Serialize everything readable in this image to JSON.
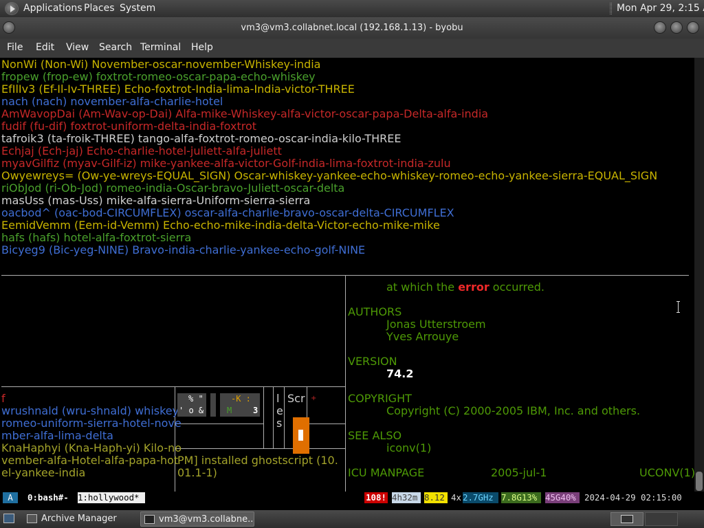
{
  "top_panel": {
    "menus": [
      "Applications",
      "Places",
      "System"
    ],
    "clock": "Mon Apr 29,  2:15 AM"
  },
  "window": {
    "title": "vm3@vm3.collabnet.local (192.168.1.13) - byobu"
  },
  "menubar": [
    "File",
    "Edit",
    "View",
    "Search",
    "Terminal",
    "Help"
  ],
  "upper_lines": [
    {
      "text": "NonWi (Non-Wi) November-oscar-november-Whiskey-india",
      "color": "yel"
    },
    {
      "text": "fropew (frop-ew) foxtrot-romeo-oscar-papa-echo-whiskey",
      "color": "grn"
    },
    {
      "text": "EfIlIv3 (Ef-Il-Iv-THREE) Echo-foxtrot-India-lima-India-victor-THREE",
      "color": "yel"
    },
    {
      "text": "nach (nach) november-alfa-charlie-hotel",
      "color": "blu"
    },
    {
      "text": "AmWavopDai (Am-Wav-op-Dai) Alfa-mike-Whiskey-alfa-victor-oscar-papa-Delta-alfa-india",
      "color": "red"
    },
    {
      "text": "fudif (fu-dif) foxtrot-uniform-delta-india-foxtrot",
      "color": "red"
    },
    {
      "text": "tafroik3 (ta-froik-THREE) tango-alfa-foxtrot-romeo-oscar-india-kilo-THREE",
      "color": "wht"
    },
    {
      "text": "Echjaj (Ech-jaj) Echo-charlie-hotel-juliett-alfa-juliett",
      "color": "red"
    },
    {
      "text": "myavGilfiz (myav-Gilf-iz) mike-yankee-alfa-victor-Golf-india-lima-foxtrot-india-zulu",
      "color": "red"
    },
    {
      "text": "Owyewreys= (Ow-ye-wreys-EQUAL_SIGN) Oscar-whiskey-yankee-echo-whiskey-romeo-echo-yankee-sierra-EQUAL_SIGN",
      "color": "yel"
    },
    {
      "text": "riObJod (ri-Ob-Jod) romeo-india-Oscar-bravo-Juliett-oscar-delta",
      "color": "grn"
    },
    {
      "text": "masUss (mas-Uss) mike-alfa-sierra-Uniform-sierra-sierra",
      "color": "wht"
    },
    {
      "text": "oacbod^ (oac-bod-CIRCUMFLEX) oscar-alfa-charlie-bravo-oscar-delta-CIRCUMFLEX",
      "color": "blu"
    },
    {
      "text": "EemidVemm (Eem-id-Vemm) Echo-echo-mike-india-delta-Victor-echo-mike-mike",
      "color": "yel"
    },
    {
      "text": "hafs (hafs) hotel-alfa-foxtrot-sierra",
      "color": "grn"
    },
    {
      "text": "Bicyeg9 (Bic-yeg-NINE) Bravo-india-charlie-yankee-echo-golf-NINE",
      "color": "blu"
    }
  ],
  "man_page": {
    "line1_pre": "at which the ",
    "line1_err": "error",
    "line1_post": " occurred.",
    "authors_heading": "AUTHORS",
    "authors": [
      "Jonas Utterstroem",
      "Yves Arrouye"
    ],
    "version_heading": "VERSION",
    "version": "74.2",
    "copyright_heading": "COPYRIGHT",
    "copyright": "Copyright (C) 2000-2005 IBM, Inc. and others.",
    "see_also_heading": "SEE ALSO",
    "see_also": "iconv(1)",
    "footer_left": "ICU MANPAGE",
    "footer_mid": "2005-jul-1",
    "footer_right": "UCONV(1)"
  },
  "hollywood_left": {
    "marker": "f",
    "lines": [
      {
        "text": "wrushnald (wru-shnald) whiskey-",
        "color": "blu"
      },
      {
        "text": "romeo-uniform-sierra-hotel-nove",
        "color": "blu"
      },
      {
        "text": "mber-alfa-lima-delta",
        "color": "blu"
      },
      {
        "text": "KnaHaphyi (Kna-Haph-yi) Kilo-no",
        "color": "olv"
      },
      {
        "text": "vember-alfa-Hotel-alfa-papa-hot",
        "color": "olv"
      },
      {
        "text": "el-yankee-india",
        "color": "olv"
      }
    ]
  },
  "mini_panes": {
    "blockA_top": "% \"",
    "blockA_bottom": "' o &",
    "blockB_top": "-K :",
    "blockB_m": "M",
    "blockB_num": "3",
    "vertical": [
      "l",
      "e",
      "s"
    ],
    "scr": "Scr",
    "plus": "+",
    "apt_line1": "PM] installed ghostscript (10.",
    "apt_line2": "01.1-1)"
  },
  "statusbar": {
    "logo": "A",
    "win0": "0:bash#-",
    "win1": "1:hollywood*",
    "updates": "108!",
    "uptime": "4h32m",
    "load": "8.12",
    "cpu_count": "4x",
    "cpu_freq": "2.7GHz",
    "mem": "7.8G13%",
    "disk": "45G40%",
    "datetime": "2024-04-29 02:15:00"
  },
  "taskbar": {
    "tasks": [
      "Archive Manager",
      "vm3@vm3.collabne..."
    ]
  },
  "colors": {
    "yel": "#c8b400",
    "grn": "#4aa02c",
    "blu": "#3f6ed4",
    "red": "#c62828",
    "wht": "#d0d0d0",
    "olv": "#a3a32a",
    "updates_bg": "#cc0000",
    "uptime_bg": "#c8d8e8",
    "load_bg": "#f2e100",
    "cpu_bg": "#0a4a6a",
    "mem_bg": "#3b6b1e",
    "disk_bg": "#7a3f7a",
    "orange": "#e06f00"
  }
}
